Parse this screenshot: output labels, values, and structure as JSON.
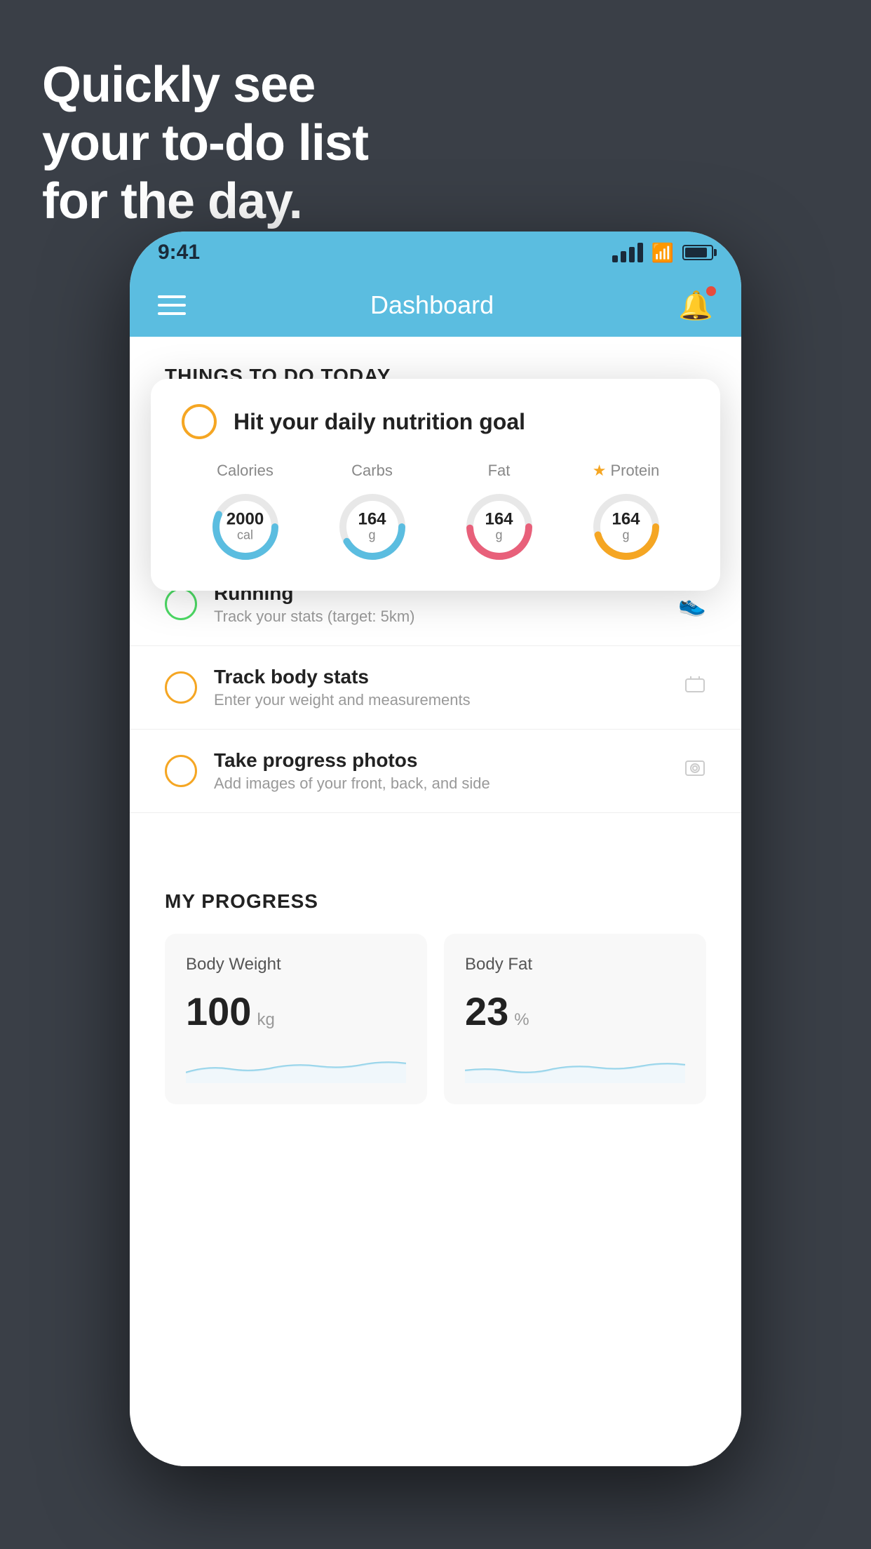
{
  "background": {
    "color": "#3a3f47"
  },
  "headline": {
    "line1": "Quickly see",
    "line2": "your to-do list",
    "line3": "for the day."
  },
  "status_bar": {
    "time": "9:41",
    "signal": "signal-icon",
    "wifi": "wifi-icon",
    "battery": "battery-icon"
  },
  "nav": {
    "menu_icon": "hamburger-icon",
    "title": "Dashboard",
    "bell_icon": "bell-icon"
  },
  "things_section": {
    "header": "THINGS TO DO TODAY"
  },
  "nutrition_card": {
    "check_label": "circle-check-icon",
    "title": "Hit your daily nutrition goal",
    "nutrients": [
      {
        "label": "Calories",
        "value": "2000",
        "unit": "cal",
        "color": "#5bbde0",
        "starred": false
      },
      {
        "label": "Carbs",
        "value": "164",
        "unit": "g",
        "color": "#5bbde0",
        "starred": false
      },
      {
        "label": "Fat",
        "value": "164",
        "unit": "g",
        "color": "#e8607a",
        "starred": false
      },
      {
        "label": "Protein",
        "value": "164",
        "unit": "g",
        "color": "#f5a623",
        "starred": true
      }
    ]
  },
  "todo_items": [
    {
      "title": "Running",
      "subtitle": "Track your stats (target: 5km)",
      "check_color": "green",
      "icon": "running-icon"
    },
    {
      "title": "Track body stats",
      "subtitle": "Enter your weight and measurements",
      "check_color": "yellow",
      "icon": "scale-icon"
    },
    {
      "title": "Take progress photos",
      "subtitle": "Add images of your front, back, and side",
      "check_color": "yellow",
      "icon": "photo-icon"
    }
  ],
  "progress_section": {
    "header": "MY PROGRESS",
    "cards": [
      {
        "title": "Body Weight",
        "value": "100",
        "unit": "kg"
      },
      {
        "title": "Body Fat",
        "value": "23",
        "unit": "%"
      }
    ]
  }
}
